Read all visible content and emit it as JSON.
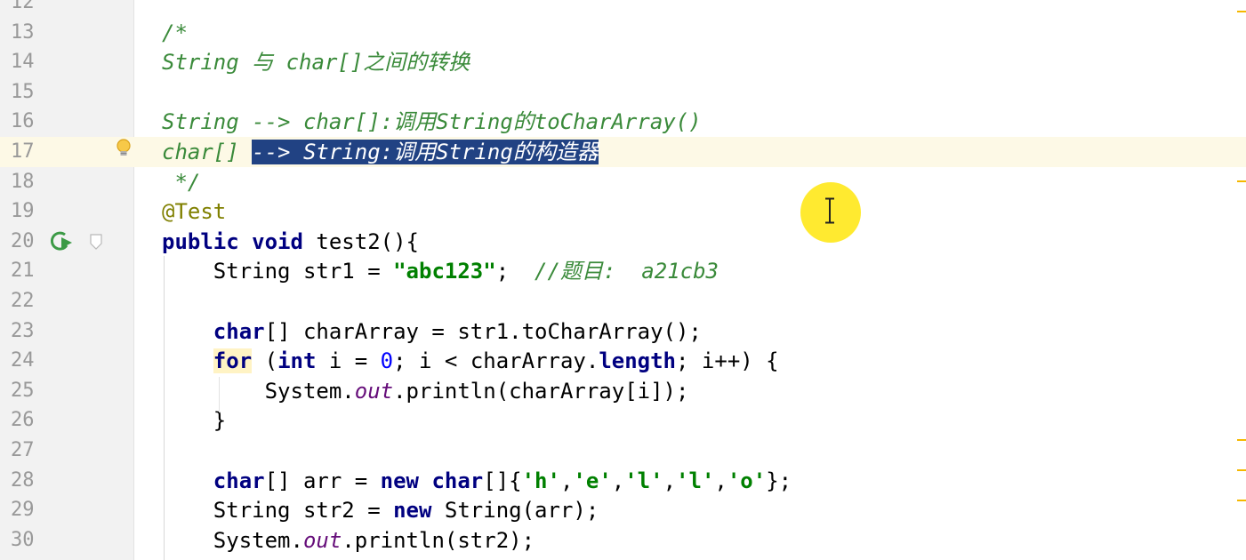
{
  "editor": {
    "lines": [
      {
        "num": "12",
        "segments": []
      },
      {
        "num": "13",
        "segments": [
          {
            "t": "/*",
            "c": "cmt"
          }
        ]
      },
      {
        "num": "14",
        "segments": [
          {
            "t": "String 与 char[]之间的转换",
            "c": "cmt"
          }
        ]
      },
      {
        "num": "15",
        "segments": []
      },
      {
        "num": "16",
        "segments": [
          {
            "t": "String --> char[]:调用String的toCharArray()",
            "c": "cmt"
          }
        ]
      },
      {
        "num": "17",
        "current": true,
        "segments": [
          {
            "t": "char[] ",
            "c": "cmt"
          },
          {
            "t": "--> String:调用String的构造器",
            "c": "sel"
          }
        ]
      },
      {
        "num": "18",
        "segments": [
          {
            "t": " */",
            "c": "cmt"
          }
        ]
      },
      {
        "num": "19",
        "segments": [
          {
            "t": "@Test",
            "c": "ann"
          }
        ]
      },
      {
        "num": "20",
        "segments": [
          {
            "t": "public",
            "c": "kw"
          },
          {
            "t": " ",
            "c": ""
          },
          {
            "t": "void",
            "c": "kw"
          },
          {
            "t": " test2(){",
            "c": ""
          }
        ]
      },
      {
        "num": "21",
        "segments": [
          {
            "t": "    String str1 = ",
            "c": ""
          },
          {
            "t": "\"abc123\"",
            "c": "str"
          },
          {
            "t": ";  ",
            "c": ""
          },
          {
            "t": "//题目:  a21cb3",
            "c": "cmt"
          }
        ]
      },
      {
        "num": "22",
        "segments": []
      },
      {
        "num": "23",
        "segments": [
          {
            "t": "    ",
            "c": ""
          },
          {
            "t": "char",
            "c": "kw"
          },
          {
            "t": "[] charArray = str1.toCharArray();",
            "c": ""
          }
        ]
      },
      {
        "num": "24",
        "segments": [
          {
            "t": "    ",
            "c": ""
          },
          {
            "t": "for",
            "c": "kw hl"
          },
          {
            "t": " (",
            "c": ""
          },
          {
            "t": "int",
            "c": "kw"
          },
          {
            "t": " i = ",
            "c": ""
          },
          {
            "t": "0",
            "c": "num"
          },
          {
            "t": "; i < charArray.",
            "c": ""
          },
          {
            "t": "length",
            "c": "kw"
          },
          {
            "t": "; i++) {",
            "c": ""
          }
        ]
      },
      {
        "num": "25",
        "segments": [
          {
            "t": "        System.",
            "c": ""
          },
          {
            "t": "out",
            "c": "fld"
          },
          {
            "t": ".println(charArray[i]);",
            "c": ""
          }
        ]
      },
      {
        "num": "26",
        "segments": [
          {
            "t": "    }",
            "c": ""
          }
        ]
      },
      {
        "num": "27",
        "segments": []
      },
      {
        "num": "28",
        "segments": [
          {
            "t": "    ",
            "c": ""
          },
          {
            "t": "char",
            "c": "kw"
          },
          {
            "t": "[] arr = ",
            "c": ""
          },
          {
            "t": "new",
            "c": "kw"
          },
          {
            "t": " ",
            "c": ""
          },
          {
            "t": "char",
            "c": "kw"
          },
          {
            "t": "[]{",
            "c": ""
          },
          {
            "t": "'h'",
            "c": "str"
          },
          {
            "t": ",",
            "c": ""
          },
          {
            "t": "'e'",
            "c": "str"
          },
          {
            "t": ",",
            "c": ""
          },
          {
            "t": "'l'",
            "c": "str"
          },
          {
            "t": ",",
            "c": ""
          },
          {
            "t": "'l'",
            "c": "str"
          },
          {
            "t": ",",
            "c": ""
          },
          {
            "t": "'o'",
            "c": "str"
          },
          {
            "t": "};",
            "c": ""
          }
        ]
      },
      {
        "num": "29",
        "segments": [
          {
            "t": "    String str2 = ",
            "c": ""
          },
          {
            "t": "new",
            "c": "kw"
          },
          {
            "t": " String(arr);",
            "c": ""
          }
        ]
      },
      {
        "num": "30",
        "segments": [
          {
            "t": "    System.",
            "c": ""
          },
          {
            "t": "out",
            "c": "fld"
          },
          {
            "t": ".println(str2);",
            "c": ""
          }
        ]
      }
    ]
  },
  "gutter_icons": {
    "bulb": "lightbulb-icon",
    "run": "run-test-icon",
    "fold": "fold-icon"
  },
  "colors": {
    "keyword": "#000080",
    "string": "#008000",
    "comment": "#3a8a3a",
    "selection": "#214283",
    "current_line": "#fdf9e6",
    "cursor_halo": "#ffe81a"
  }
}
